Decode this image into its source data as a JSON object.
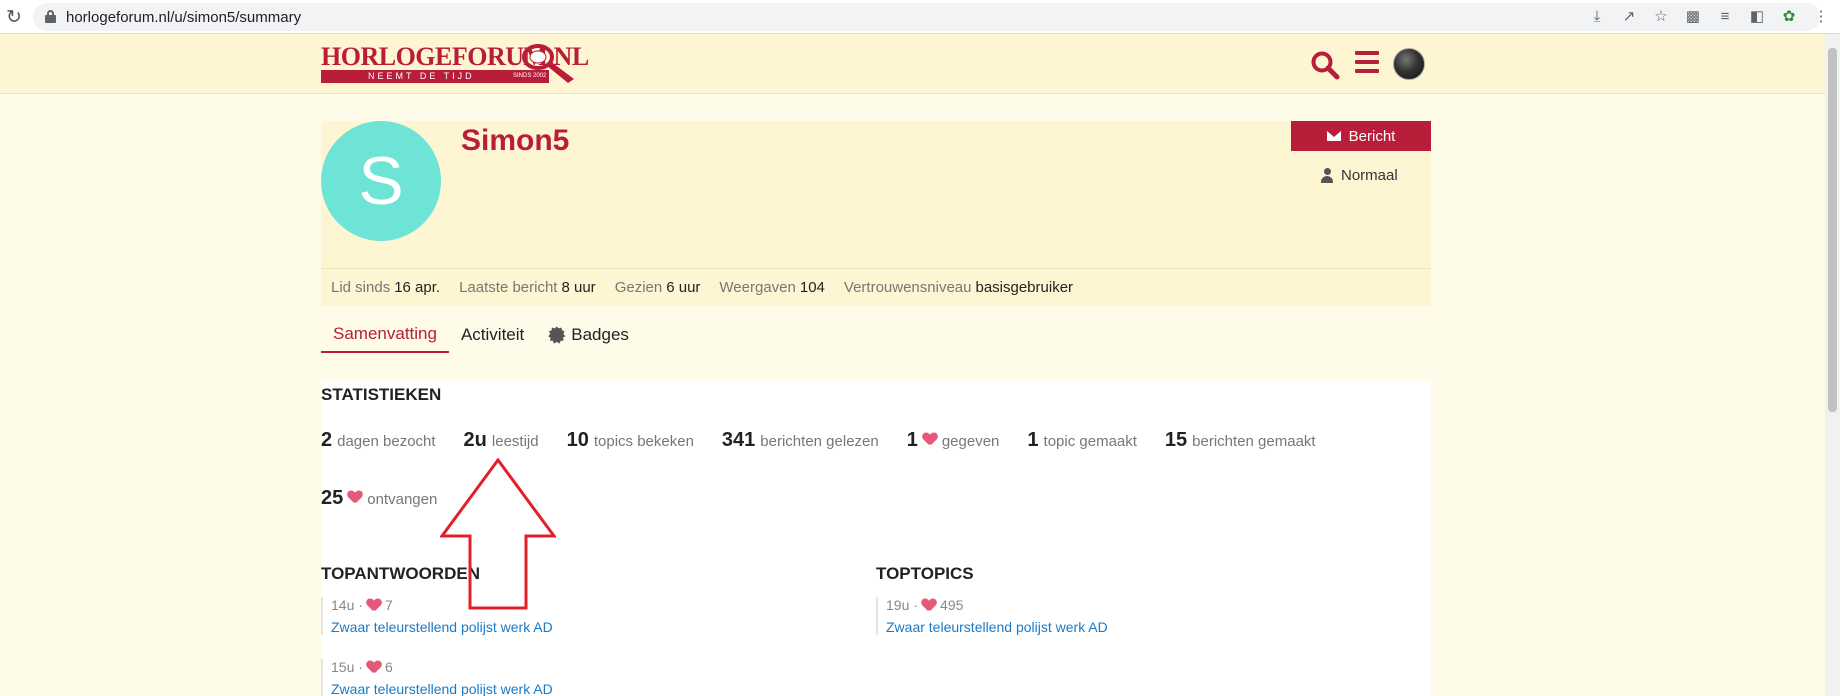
{
  "browser": {
    "url": "horlogeforum.nl/u/simon5/summary"
  },
  "site": {
    "logo_title": "HORLOGEFORUM.NL",
    "logo_tagline": "NEEMT DE TIJD",
    "logo_since": "SINDS 2002"
  },
  "profile": {
    "avatar_letter": "S",
    "name": "Simon5",
    "message_button": "Bericht",
    "trust_level": "Normaal",
    "meta": [
      {
        "label": "Lid sinds",
        "value": "16 apr."
      },
      {
        "label": "Laatste bericht",
        "value": "8 uur"
      },
      {
        "label": "Gezien",
        "value": "6 uur"
      },
      {
        "label": "Weergaven",
        "value": "104"
      },
      {
        "label": "Vertrouwensniveau",
        "value": "basisgebruiker"
      }
    ]
  },
  "tabs": [
    "Samenvatting",
    "Activiteit",
    "Badges"
  ],
  "stats": {
    "title": "STATISTIEKEN",
    "items": [
      {
        "num": "2",
        "label": "dagen bezocht"
      },
      {
        "num": "2u",
        "label": "leestijd"
      },
      {
        "num": "10",
        "label": "topics bekeken"
      },
      {
        "num": "341",
        "label": "berichten gelezen"
      },
      {
        "num": "1",
        "label": "gegeven"
      },
      {
        "num": "1",
        "label": "topic gemaakt"
      },
      {
        "num": "15",
        "label": "berichten gemaakt"
      },
      {
        "num": "25",
        "label": "ontvangen"
      }
    ]
  },
  "top_replies": {
    "title": "TOPANTWOORDEN",
    "posts": [
      {
        "age": "14u",
        "likes": "7",
        "title": "Zwaar teleurstellend polijst werk AD"
      },
      {
        "age": "15u",
        "likes": "6",
        "title": "Zwaar teleurstellend polijst werk AD"
      }
    ]
  },
  "top_topics": {
    "title": "TOPTOPICS",
    "posts": [
      {
        "age": "19u",
        "likes": "495",
        "title": "Zwaar teleurstellend polijst werk AD"
      }
    ]
  },
  "colors": {
    "brand": "#b81d3a",
    "header_bg": "#fef5d2",
    "avatar_bg": "#6de4d6",
    "link": "#1a7ac6",
    "heart": "#e45979",
    "annotation_arrow": "#e0202a"
  }
}
